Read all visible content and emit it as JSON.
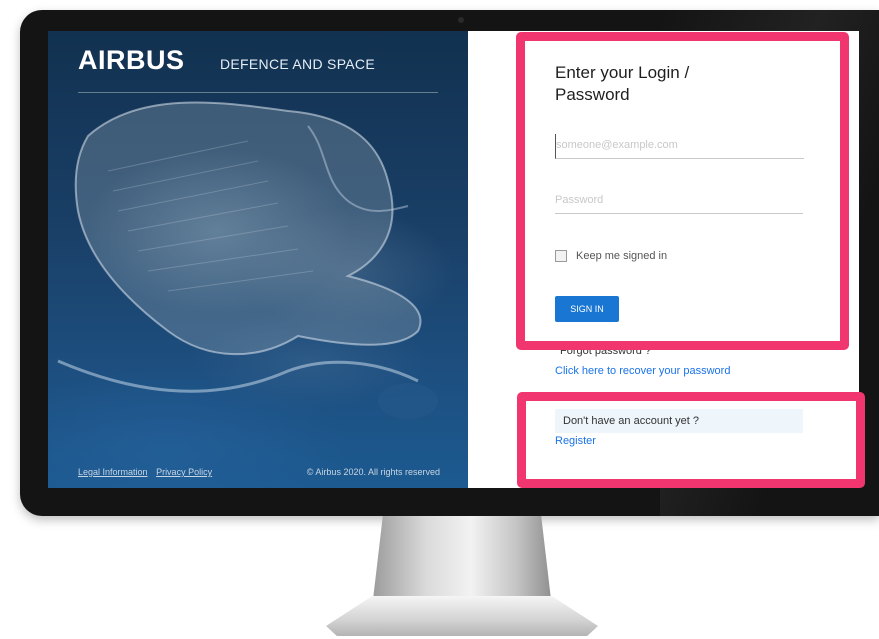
{
  "brand": {
    "logo": "AIRBUS",
    "subtitle": "DEFENCE AND SPACE"
  },
  "hero_footer": {
    "links": [
      "Legal Information",
      "Privacy Policy"
    ],
    "copyright": "© Airbus 2020. All rights reserved"
  },
  "login": {
    "title": "Enter your Login / Password",
    "email_placeholder": "someone@example.com",
    "password_placeholder": "Password",
    "keep_signed_in_label": "Keep me signed in",
    "keep_signed_in_checked": false,
    "signin_label": "SIGN IN",
    "forgot_label": "Forgot password ?",
    "recover_link": "Click here to recover your password"
  },
  "register": {
    "prompt": "Don't have an account yet ?",
    "link": "Register"
  },
  "colors": {
    "accent": "#1976d2",
    "highlight": "#f0356f",
    "link": "#1a73e8"
  }
}
